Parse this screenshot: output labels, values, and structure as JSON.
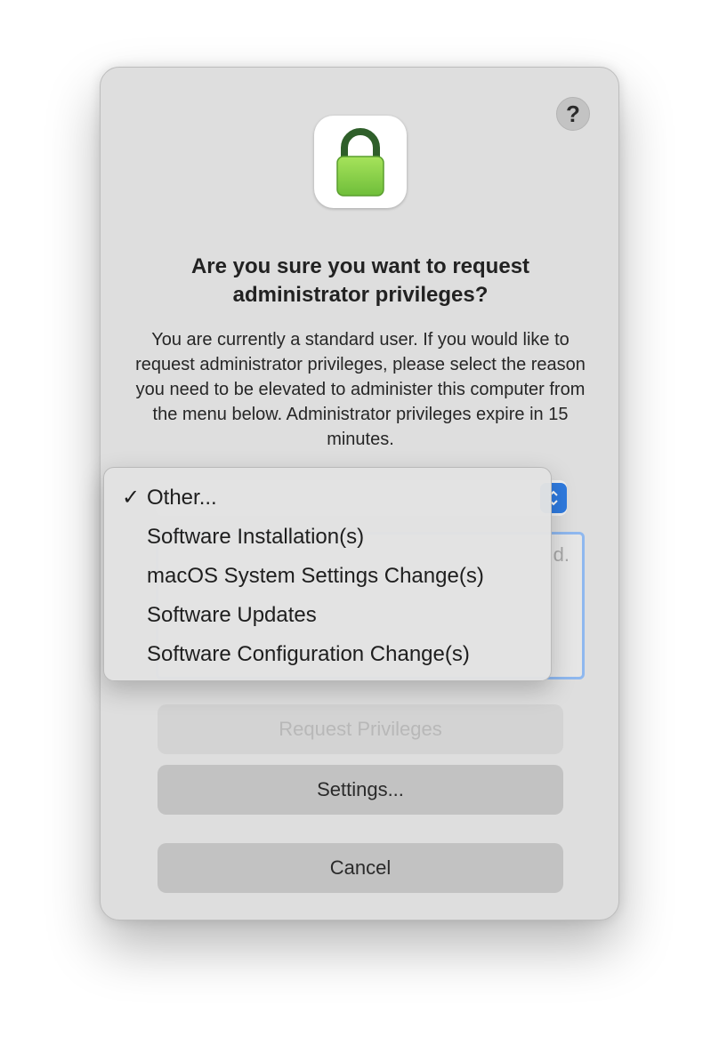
{
  "dialog": {
    "help_label": "?",
    "title": "Are you sure you want to request administrator privileges?",
    "message": "You are currently a standard user. If you would like to request administrator privileges, please select the reason you need to be elevated to administer this computer from the menu below. Administrator privileges expire in 15 minutes.",
    "reason_placeholder_fragment": "d.",
    "buttons": {
      "request": "Request Privileges",
      "settings": "Settings...",
      "cancel": "Cancel"
    }
  },
  "menu": {
    "check_glyph": "✓",
    "items": [
      {
        "label": "Other...",
        "checked": true
      },
      {
        "label": "Software Installation(s)",
        "checked": false
      },
      {
        "label": "macOS System Settings Change(s)",
        "checked": false
      },
      {
        "label": "Software Updates",
        "checked": false
      },
      {
        "label": "Software Configuration Change(s)",
        "checked": false
      }
    ]
  },
  "icons": {
    "app": "lock-icon",
    "stepper": "chevron-updown-icon"
  },
  "colors": {
    "accent": "#2f7be0",
    "lock_green": "#8bd14a",
    "lock_shackle": "#2f5f2a"
  }
}
